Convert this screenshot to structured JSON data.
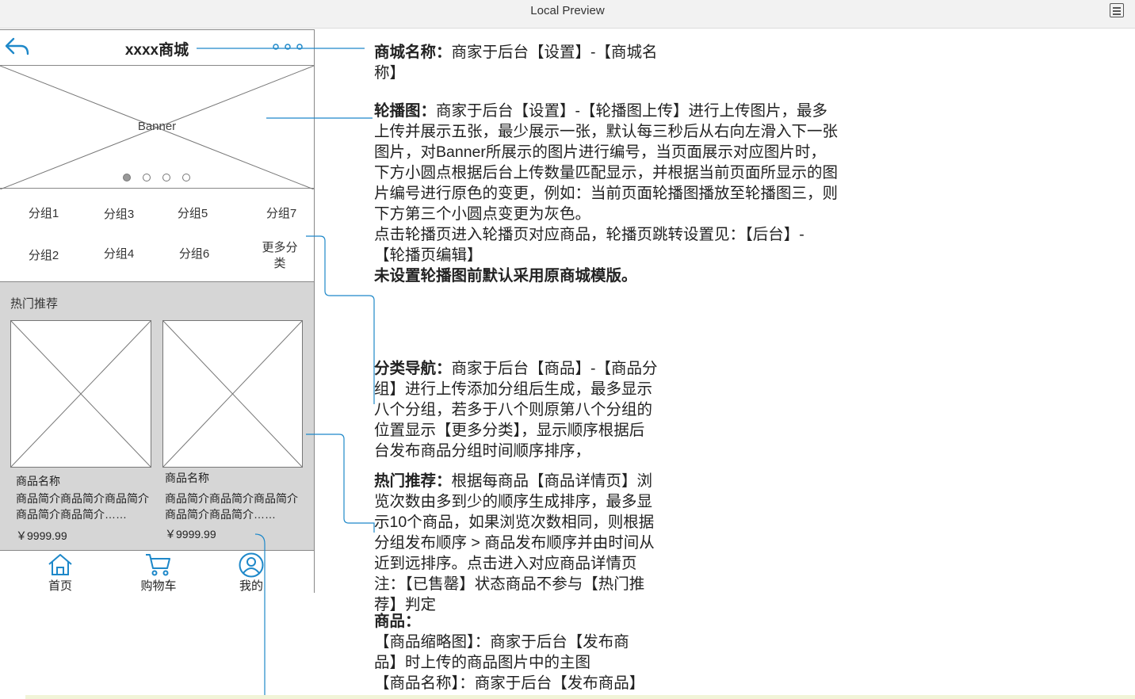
{
  "window": {
    "title": "Local Preview",
    "menu_icon": "list-icon"
  },
  "phone": {
    "header": {
      "back_icon": "back-arrow-icon",
      "shop_name": "xxxx商城",
      "more_icon": "more-dots-icon"
    },
    "banner": {
      "label": "Banner",
      "dots": [
        {
          "state": "active"
        },
        {
          "state": "inactive"
        },
        {
          "state": "inactive"
        },
        {
          "state": "inactive"
        }
      ]
    },
    "categories": {
      "row1": [
        "分组1",
        "分组3",
        "分组5",
        "分组7"
      ],
      "row2": [
        "分组2",
        "分组4",
        "分组6"
      ],
      "more": "更多分类"
    },
    "hot": {
      "title": "热门推荐",
      "products": [
        {
          "name": "商品名称",
          "desc": "商品简介商品简介商品简介商品简介商品简介……",
          "price": "￥9999.99"
        },
        {
          "name": "商品名称",
          "desc": "商品简介商品简介商品简介商品简介商品简介……",
          "price": "￥9999.99"
        }
      ]
    },
    "tabbar": [
      {
        "label": "首页",
        "icon": "home-icon"
      },
      {
        "label": "购物车",
        "icon": "cart-icon"
      },
      {
        "label": "我的",
        "icon": "user-icon"
      }
    ]
  },
  "annotations": {
    "shop_name": {
      "title": "商城名称：",
      "line1": "商家于后台【设置】-【商城名",
      "line2": "称】"
    },
    "banner": {
      "title": "轮播图：",
      "lines": [
        "商家于后台【设置】-【轮播图上传】进行上传图片，最多",
        "上传并展示五张，最少展示一张，默认每三秒后从右向左滑入下一张",
        "图片，对Banner所展示的图片进行编号，当页面展示对应图片时，",
        "下方小圆点根据后台上传数量匹配显示，并根据当前页面所显示的图",
        "片编号进行原色的变更，例如：当前页面轮播图播放至轮播图三，则",
        "下方第三个小圆点变更为灰色。",
        "点击轮播页进入轮播页对应商品，轮播页跳转设置见：【后台】-",
        "【轮播页编辑】"
      ],
      "note": "未设置轮播图前默认采用原商城模版。"
    },
    "category": {
      "title": "分类导航：",
      "lines": [
        "商家于后台【商品】-【商品分",
        "组】进行上传添加分组后生成，最多显示",
        "八个分组，若多于八个则原第八个分组的",
        "位置显示【更多分类】，显示顺序根据后",
        "台发布商品分组时间顺序排序，"
      ]
    },
    "hot": {
      "title": "热门推荐：",
      "lines": [
        "根据每商品【商品详情页】浏",
        "览次数由多到少的顺序生成排序，最多显",
        "示10个商品，如果浏览次数相同，则根据",
        "分组发布顺序 > 商品发布顺序并由时间从",
        "近到远排序。点击进入对应商品详情页",
        "注：【已售罄】状态商品不参与【热门推",
        "荐】判定"
      ]
    },
    "product": {
      "title": "商品：",
      "lines": [
        "【商品缩略图】：商家于后台【发布商",
        "品】时上传的商品图片中的主图",
        "【商品名称】：商家于后台【发布商品】"
      ]
    }
  }
}
